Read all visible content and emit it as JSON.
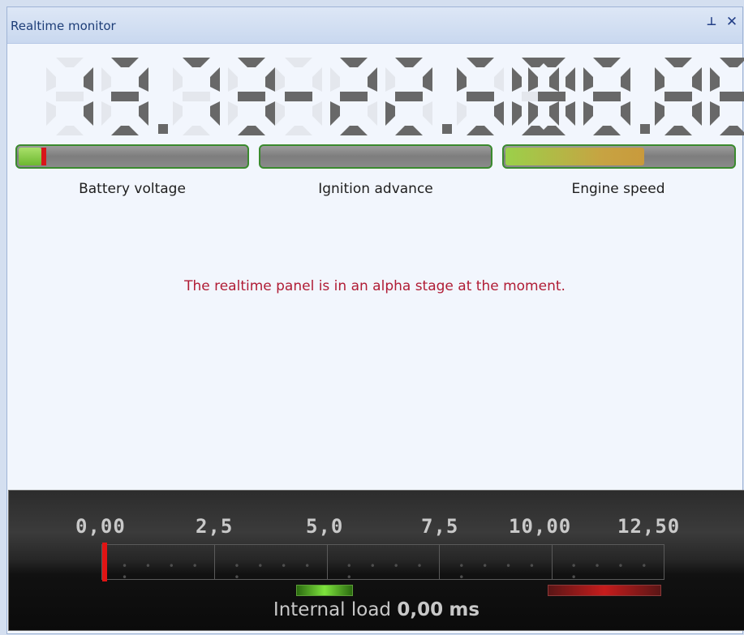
{
  "window": {
    "title": "Realtime monitor",
    "pin_glyph": "⊥",
    "close_glyph": "✕"
  },
  "displays": [
    {
      "name": "battery-voltage",
      "value": "13.73",
      "label": "Battery voltage",
      "bar_fraction": 0.1,
      "bar_color": "#8fd14a",
      "marker": true
    },
    {
      "name": "ignition-advance",
      "value": "-22.50",
      "label": "Ignition advance",
      "bar_fraction": 0.0,
      "bar_color": "#8fd14a",
      "marker": false
    },
    {
      "name": "engine-speed",
      "value": "88.88",
      "label": "Engine speed",
      "bar_fraction": 0.61,
      "bar_color": "#b9b342",
      "marker": false
    }
  ],
  "message": "The realtime panel is in an alpha stage at the moment.",
  "load_meter": {
    "ticks": [
      "0,00",
      "2,5",
      "5,0",
      "7,5",
      "10,00",
      "12,50"
    ],
    "value_label": "Internal load",
    "value": "0,00",
    "unit": "ms"
  },
  "colors": {
    "accent_title": "#1e3e78",
    "message": "#b01c35",
    "bar_border": "#3a8a2e",
    "needle": "#e01414"
  }
}
